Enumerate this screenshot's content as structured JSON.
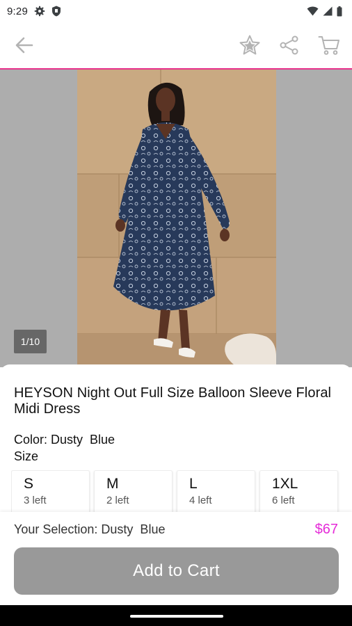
{
  "status_bar": {
    "time": "9:29",
    "icons": [
      "settings-gear-icon",
      "shield-icon",
      "wifi-icon",
      "cell-signal-icon",
      "battery-icon"
    ]
  },
  "app_bar": {
    "icons": [
      "back-arrow-icon",
      "star-icon",
      "share-icon",
      "cart-icon"
    ],
    "accent_color": "#e8308c"
  },
  "gallery": {
    "counter": "1/10"
  },
  "product": {
    "title": "HEYSON Night Out Full Size Balloon Sleeve Floral Midi Dress",
    "color_line": "Color: Dusty  Blue",
    "size_heading": "Size",
    "sizes": [
      {
        "name": "S",
        "stock": "3 left"
      },
      {
        "name": "M",
        "stock": "2 left"
      },
      {
        "name": "L",
        "stock": "4 left"
      },
      {
        "name": "1XL",
        "stock": "6 left"
      }
    ]
  },
  "footer": {
    "selection": "Your Selection: Dusty  Blue",
    "price": "$67",
    "price_color": "#e52bd8",
    "add_to_cart": "Add to Cart"
  }
}
